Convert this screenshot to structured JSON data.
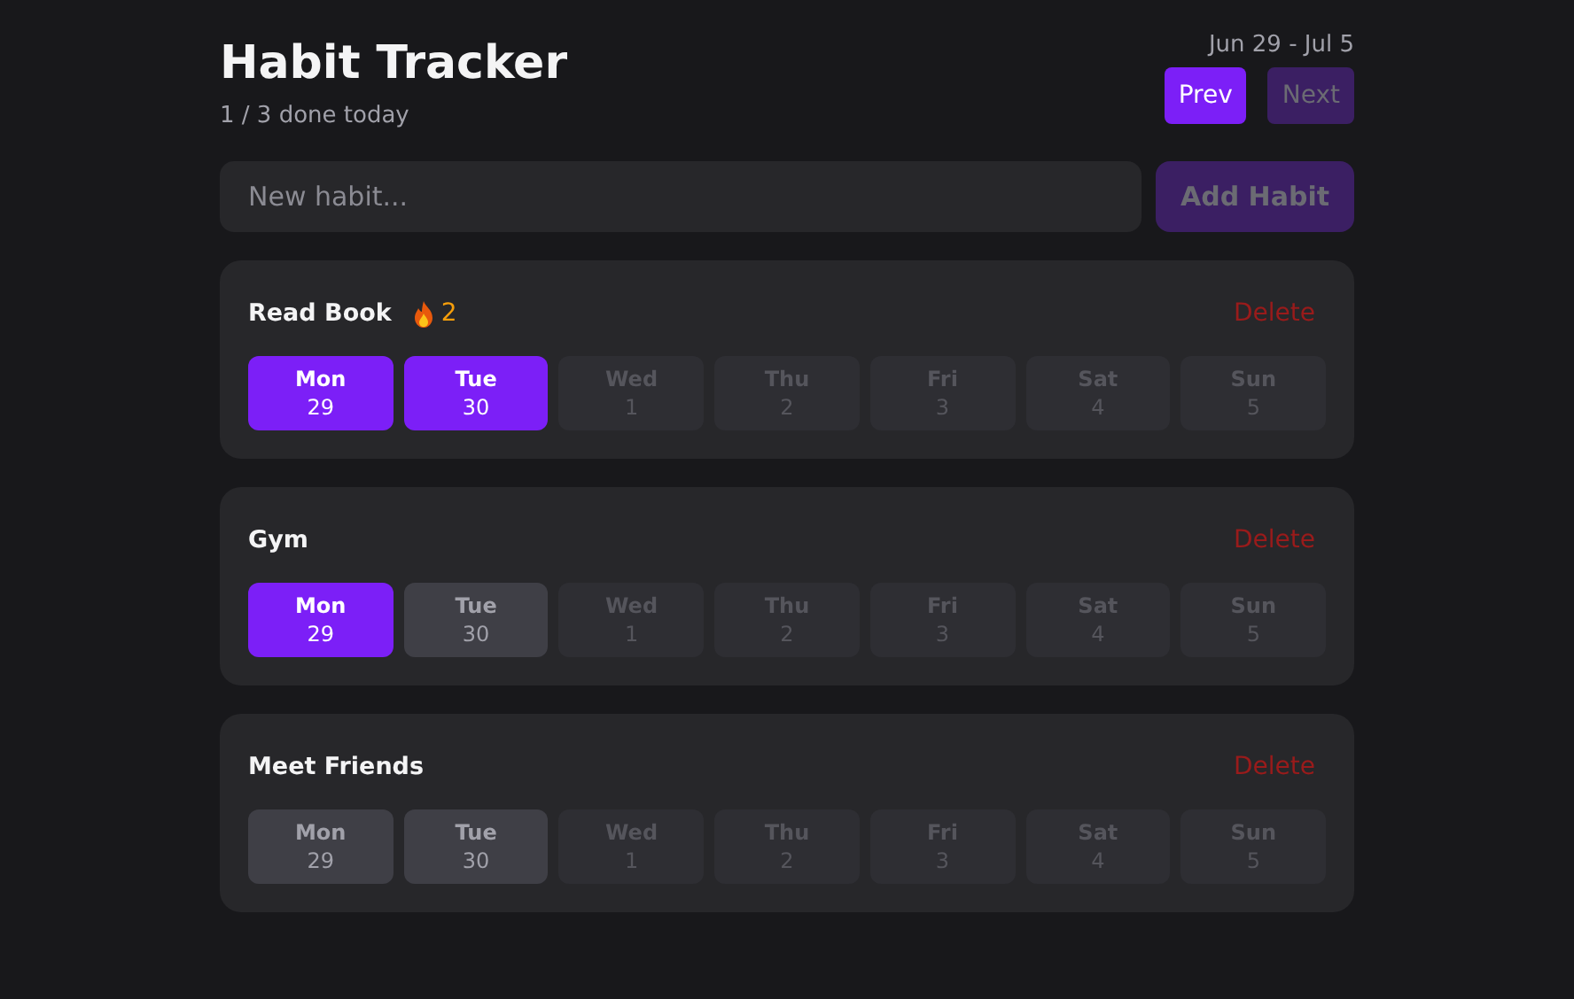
{
  "header": {
    "title": "Habit Tracker",
    "summary": "1 / 3 done today",
    "week_range": "Jun 29 - Jul 5",
    "buttons": [
      {
        "label": "Prev",
        "disabled": false
      },
      {
        "label": "Next",
        "disabled": true
      }
    ]
  },
  "new_habit": {
    "placeholder": "New habit...",
    "button": {
      "label": "Add Habit",
      "disabled": true
    }
  },
  "habits": [
    {
      "name": "Read Book",
      "streak": "2",
      "delete_label": "Delete",
      "days": [
        {
          "day": "Mon",
          "date": "29",
          "checked": true,
          "disabled": false
        },
        {
          "day": "Tue",
          "date": "30",
          "checked": true,
          "disabled": false
        },
        {
          "day": "Wed",
          "date": "1",
          "checked": false,
          "disabled": true
        },
        {
          "day": "Thu",
          "date": "2",
          "checked": false,
          "disabled": true
        },
        {
          "day": "Fri",
          "date": "3",
          "checked": false,
          "disabled": true
        },
        {
          "day": "Sat",
          "date": "4",
          "checked": false,
          "disabled": true
        },
        {
          "day": "Sun",
          "date": "5",
          "checked": false,
          "disabled": true
        }
      ]
    },
    {
      "name": "Gym",
      "delete_label": "Delete",
      "days": [
        {
          "day": "Mon",
          "date": "29",
          "checked": true,
          "disabled": false
        },
        {
          "day": "Tue",
          "date": "30",
          "checked": false,
          "disabled": false
        },
        {
          "day": "Wed",
          "date": "1",
          "checked": false,
          "disabled": true
        },
        {
          "day": "Thu",
          "date": "2",
          "checked": false,
          "disabled": true
        },
        {
          "day": "Fri",
          "date": "3",
          "checked": false,
          "disabled": true
        },
        {
          "day": "Sat",
          "date": "4",
          "checked": false,
          "disabled": true
        },
        {
          "day": "Sun",
          "date": "5",
          "checked": false,
          "disabled": true
        }
      ]
    },
    {
      "name": "Meet Friends",
      "delete_label": "Delete",
      "days": [
        {
          "day": "Mon",
          "date": "29",
          "checked": false,
          "disabled": false
        },
        {
          "day": "Tue",
          "date": "30",
          "checked": false,
          "disabled": false
        },
        {
          "day": "Wed",
          "date": "1",
          "checked": false,
          "disabled": true
        },
        {
          "day": "Thu",
          "date": "2",
          "checked": false,
          "disabled": true
        },
        {
          "day": "Fri",
          "date": "3",
          "checked": false,
          "disabled": true
        },
        {
          "day": "Sat",
          "date": "4",
          "checked": false,
          "disabled": true
        },
        {
          "day": "Sun",
          "date": "5",
          "checked": false,
          "disabled": true
        }
      ]
    }
  ]
}
